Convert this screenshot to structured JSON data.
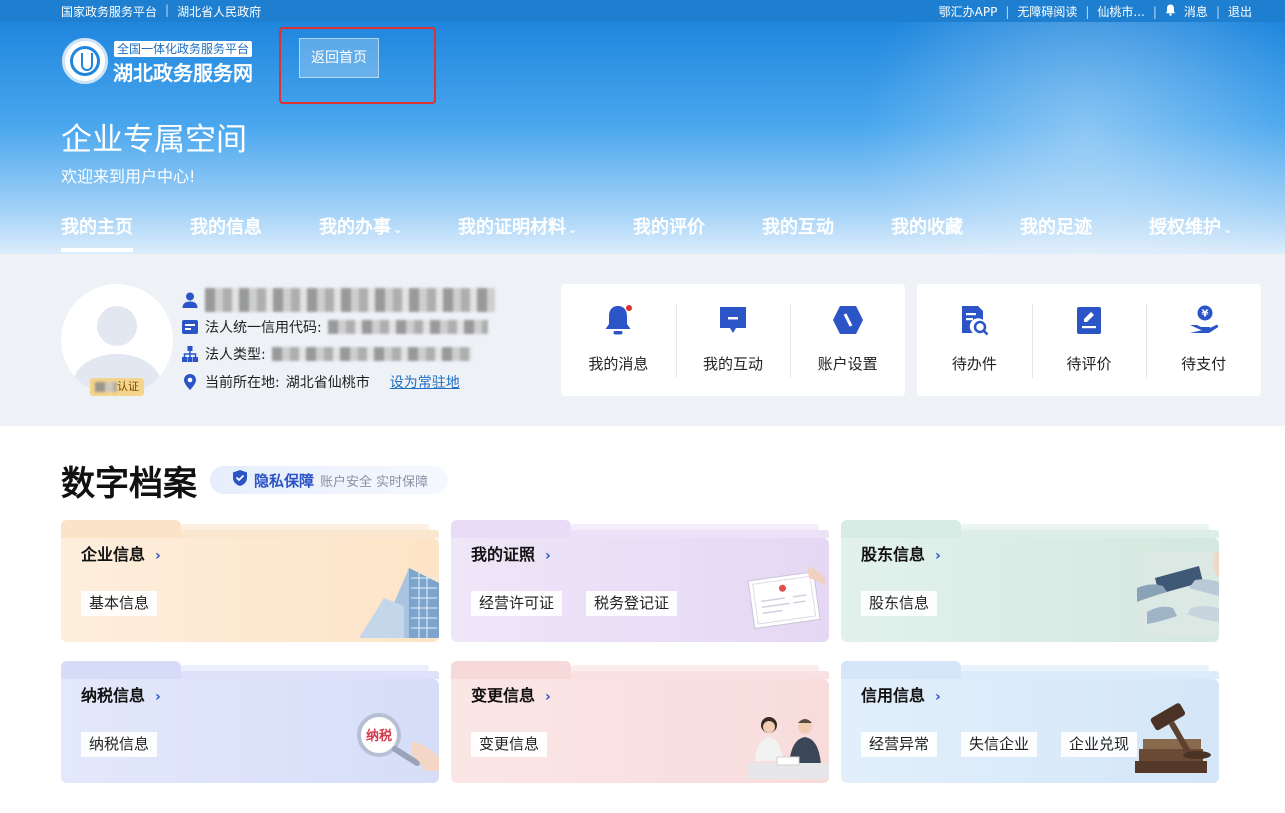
{
  "topbar": {
    "left_links": [
      "国家政务服务平台",
      "湖北省人民政府"
    ],
    "right_links": {
      "app": "鄂汇办APP",
      "accessible": "无障碍阅读",
      "city": "仙桃市...",
      "messages": "消息",
      "logout": "退出"
    }
  },
  "logo": {
    "subtitle": "全国一体化政务服务平台",
    "title": "湖北政务服务网"
  },
  "header": {
    "home_button": "返回首页",
    "space_title": "企业专属空间",
    "welcome": "欢迎来到用户中心!"
  },
  "nav": {
    "items": [
      {
        "label": "我的主页",
        "dropdown": false,
        "active": true
      },
      {
        "label": "我的信息",
        "dropdown": false
      },
      {
        "label": "我的办事",
        "dropdown": true
      },
      {
        "label": "我的证明材料",
        "dropdown": true
      },
      {
        "label": "我的评价",
        "dropdown": false
      },
      {
        "label": "我的互动",
        "dropdown": false
      },
      {
        "label": "我的收藏",
        "dropdown": false
      },
      {
        "label": "我的足迹",
        "dropdown": false
      },
      {
        "label": "授权维护",
        "dropdown": true
      }
    ]
  },
  "profile": {
    "badge": "认证",
    "credit_code_label": "法人统一信用代码:",
    "legal_type_label": "法人类型:",
    "location_label": "当前所在地:",
    "location_value": "湖北省仙桃市",
    "set_resident": "设为常驻地"
  },
  "quick": {
    "group1": [
      "我的消息",
      "我的互动",
      "账户设置"
    ],
    "group2": [
      "待办件",
      "待评价",
      "待支付"
    ]
  },
  "archive": {
    "title": "数字档案",
    "privacy_title": "隐私保障",
    "privacy_sub": "账户安全 实时保障",
    "cards": [
      {
        "title": "企业信息",
        "tags": [
          "基本信息"
        ],
        "theme": "#fdeedd"
      },
      {
        "title": "我的证照",
        "tags": [
          "经营许可证",
          "税务登记证"
        ],
        "theme": "#efe6f8"
      },
      {
        "title": "股东信息",
        "tags": [
          "股东信息"
        ],
        "theme": "#e2f1ec"
      },
      {
        "title": "纳税信息",
        "tags": [
          "纳税信息"
        ],
        "theme": "#e3e8fb",
        "stamp": "纳税"
      },
      {
        "title": "变更信息",
        "tags": [
          "变更信息"
        ],
        "theme": "#fbe6e6"
      },
      {
        "title": "信用信息",
        "tags": [
          "经营异常",
          "失信企业",
          "企业兑现"
        ],
        "theme": "#e2effb"
      }
    ]
  },
  "colors": {
    "brand_blue": "#1e7fd0",
    "accent_blue": "#2b54c7",
    "highlight_red": "#e03030"
  }
}
